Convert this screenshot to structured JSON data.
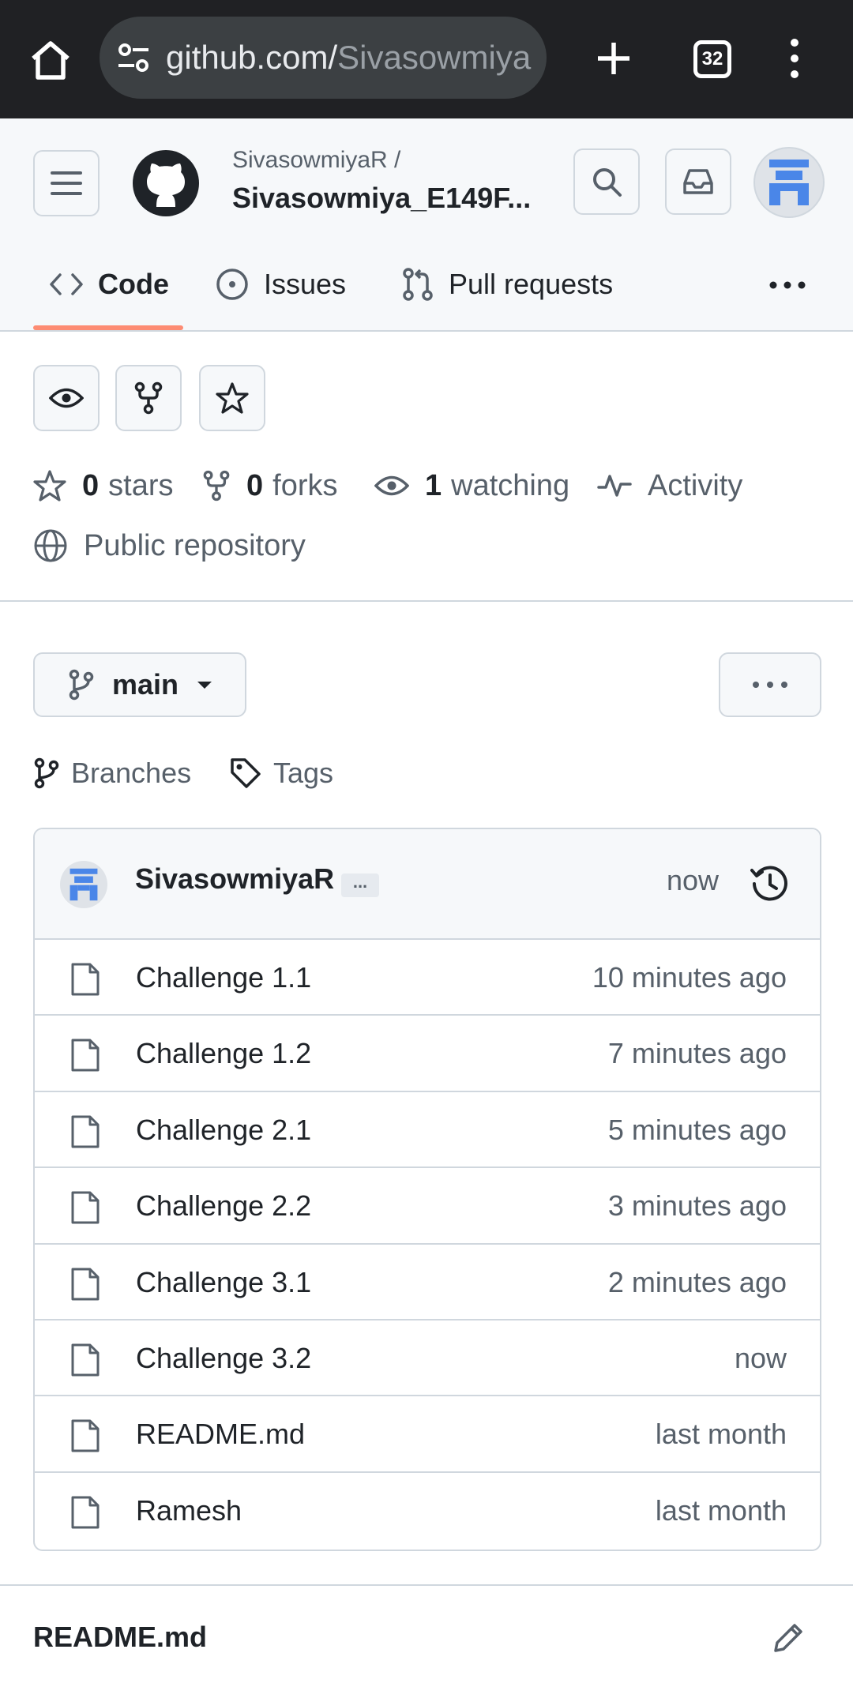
{
  "browser": {
    "url_host": "github.com/",
    "url_path": "Sivasowmiya",
    "tab_count": "32"
  },
  "header": {
    "owner": "SivasowmiyaR /",
    "repo": "Sivasowmiya_E149F..."
  },
  "tabs": [
    {
      "label": "Code",
      "active": true
    },
    {
      "label": "Issues"
    },
    {
      "label": "Pull requests"
    }
  ],
  "stats": {
    "stars_count": "0",
    "stars_label": "stars",
    "forks_count": "0",
    "forks_label": "forks",
    "watching_count": "1",
    "watching_label": "watching",
    "activity_label": "Activity",
    "visibility": "Public repository"
  },
  "branch": {
    "name": "main",
    "branches_label": "Branches",
    "tags_label": "Tags"
  },
  "commit": {
    "author": "SivasowmiyaR",
    "ellipsis": "...",
    "time": "now"
  },
  "files": [
    {
      "name": "Challenge 1.1",
      "time": "10 minutes ago"
    },
    {
      "name": "Challenge 1.2",
      "time": "7 minutes ago"
    },
    {
      "name": "Challenge 2.1",
      "time": "5 minutes ago"
    },
    {
      "name": "Challenge 2.2",
      "time": "3 minutes ago"
    },
    {
      "name": "Challenge 3.1",
      "time": "2 minutes ago"
    },
    {
      "name": "Challenge 3.2",
      "time": "now"
    },
    {
      "name": "README.md",
      "time": "last month"
    },
    {
      "name": "Ramesh",
      "time": "last month"
    }
  ],
  "readme": {
    "title": "README.md"
  },
  "colors": {
    "chrome_bg": "#202124",
    "header_bg": "#f6f8fa",
    "tab_underline": "#fd8c73",
    "avatar_blue": "#4a86e8",
    "border": "#d0d7de",
    "muted_text": "#57606a"
  },
  "icons": {
    "browser": [
      "home-icon",
      "site-settings-icon",
      "plus-icon",
      "tabs-icon",
      "kebab-menu-icon"
    ],
    "header": [
      "hamburger-icon",
      "github-logo-icon",
      "search-icon",
      "inbox-icon"
    ],
    "file": "file-icon",
    "history": "history-icon",
    "edit": "pencil-icon"
  }
}
